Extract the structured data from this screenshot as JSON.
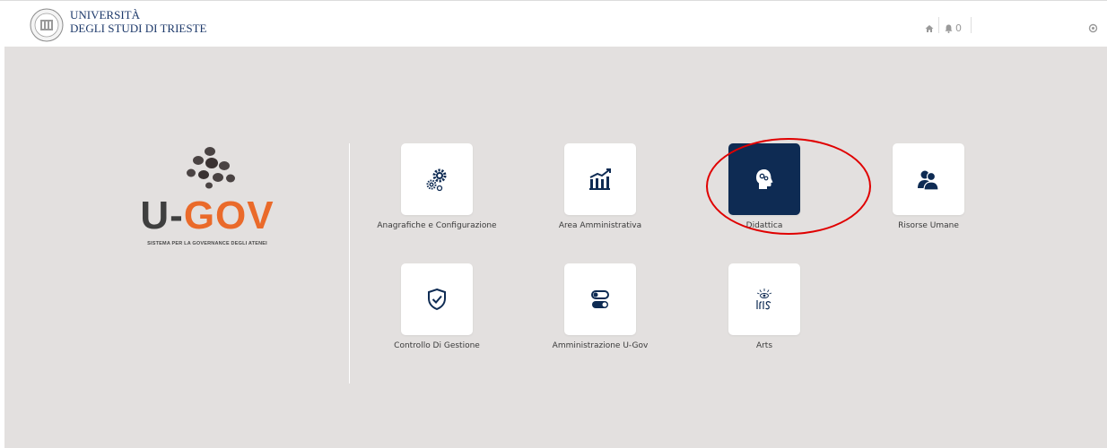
{
  "header": {
    "university_line1": "UNIVERSITÀ",
    "university_line2": "DEGLI STUDI DI TRIESTE",
    "notification_count": "0"
  },
  "brand": {
    "logo_u": "U-",
    "logo_gov": "GOV",
    "tagline": "SISTEMA PER LA GOVERNANCE DEGLI ATENEI"
  },
  "tiles": [
    {
      "label": "Anagrafiche e Configurazione",
      "icon": "gears-icon"
    },
    {
      "label": "Area Amministrativa",
      "icon": "chart-building-icon"
    },
    {
      "label": "Didattica",
      "icon": "head-brain-icon",
      "active": true
    },
    {
      "label": "Risorse Umane",
      "icon": "users-icon"
    },
    {
      "label": "Controllo Di Gestione",
      "icon": "shield-check-icon"
    },
    {
      "label": "Amministrazione U-Gov",
      "icon": "toggles-icon"
    },
    {
      "label": "Arts",
      "icon": "iris-logo-icon"
    }
  ],
  "colors": {
    "accent_dark": "#0e2b53",
    "brand_orange": "#ea6a2a",
    "highlight": "#e00000",
    "background": "#e3e0df"
  }
}
